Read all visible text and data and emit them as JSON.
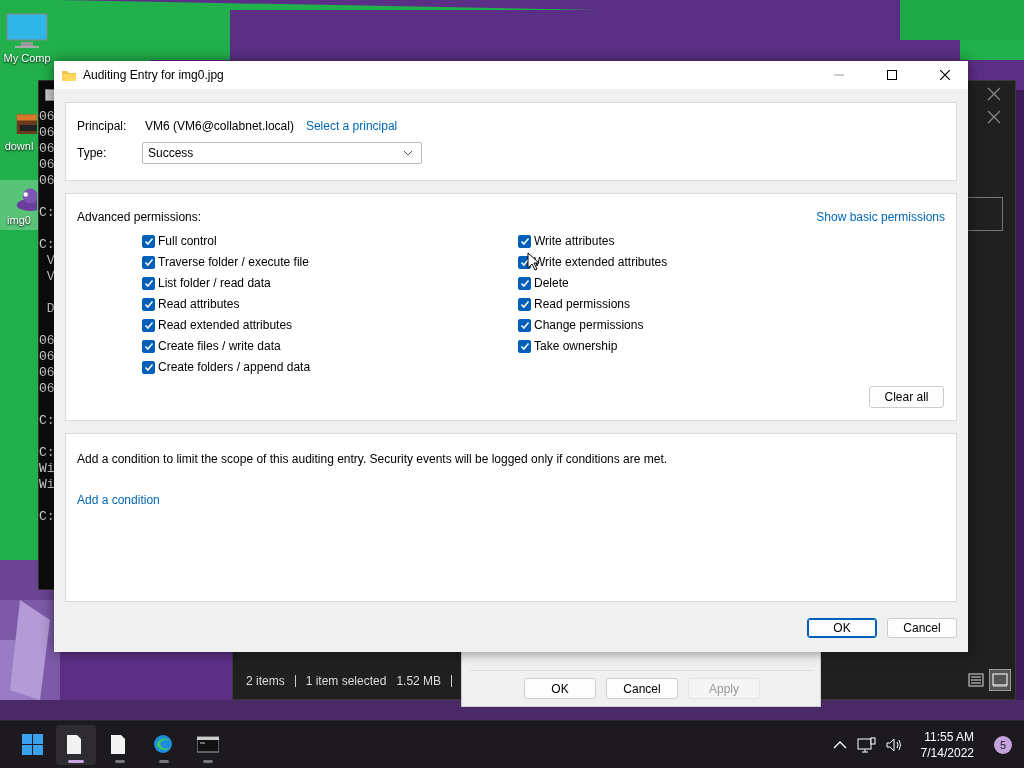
{
  "desktop_icons": [
    {
      "label": "My Comp",
      "selected": false
    },
    {
      "label": "downl",
      "selected": false
    },
    {
      "label": "img0",
      "selected": true
    }
  ],
  "console": {
    "blocks": [
      [
        "06",
        "06",
        "06",
        "06",
        "06"
      ],
      [
        "C:"
      ],
      [
        "C:",
        " V",
        " V"
      ],
      [
        " D"
      ],
      [
        "06",
        "06",
        "06",
        "06"
      ],
      [
        "C:"
      ],
      [
        "C:",
        "Wi",
        "Wi"
      ],
      [
        "C:"
      ]
    ]
  },
  "explorer": {
    "status_items": [
      "2 items",
      "1 item selected",
      "1.52 MB"
    ],
    "views": [
      {
        "kind": "details",
        "selected": false
      },
      {
        "kind": "tiles",
        "selected": true
      }
    ]
  },
  "properties_dialog": {
    "buttons": [
      {
        "label": "OK",
        "disabled": false
      },
      {
        "label": "Cancel",
        "disabled": false
      },
      {
        "label": "Apply",
        "disabled": true
      }
    ]
  },
  "dialog": {
    "title": "Auditing Entry for img0.jpg",
    "principal": {
      "label": "Principal:",
      "value": "VM6 (VM6@collabnet.local)",
      "link": "Select a principal"
    },
    "type": {
      "label": "Type:",
      "value": "Success"
    },
    "permissions": {
      "label": "Advanced permissions:",
      "toggle_link": "Show basic permissions",
      "columns": [
        [
          {
            "label": "Full control",
            "checked": true
          },
          {
            "label": "Traverse folder / execute file",
            "checked": true
          },
          {
            "label": "List folder / read data",
            "checked": true
          },
          {
            "label": "Read attributes",
            "checked": true
          },
          {
            "label": "Read extended attributes",
            "checked": true
          },
          {
            "label": "Create files / write data",
            "checked": true
          },
          {
            "label": "Create folders / append data",
            "checked": true
          }
        ],
        [
          {
            "label": "Write attributes",
            "checked": true
          },
          {
            "label": "Write extended attributes",
            "checked": true
          },
          {
            "label": "Delete",
            "checked": true
          },
          {
            "label": "Read permissions",
            "checked": true
          },
          {
            "label": "Change permissions",
            "checked": true
          },
          {
            "label": "Take ownership",
            "checked": true
          }
        ]
      ],
      "clear_button": "Clear all"
    },
    "condition": {
      "text": "Add a condition to limit the scope of this auditing entry. Security events will be logged only if conditions are met.",
      "link": "Add a condition"
    },
    "buttons": [
      {
        "label": "OK",
        "default": true
      },
      {
        "label": "Cancel",
        "default": false
      }
    ]
  },
  "taskbar": {
    "apps": [
      {
        "kind": "explorer",
        "active": true
      },
      {
        "kind": "file",
        "active": false
      },
      {
        "kind": "edge",
        "active": false
      },
      {
        "kind": "terminal",
        "active": false
      }
    ],
    "time": "11:55 AM",
    "date": "7/14/2022",
    "notification_count": "5"
  }
}
